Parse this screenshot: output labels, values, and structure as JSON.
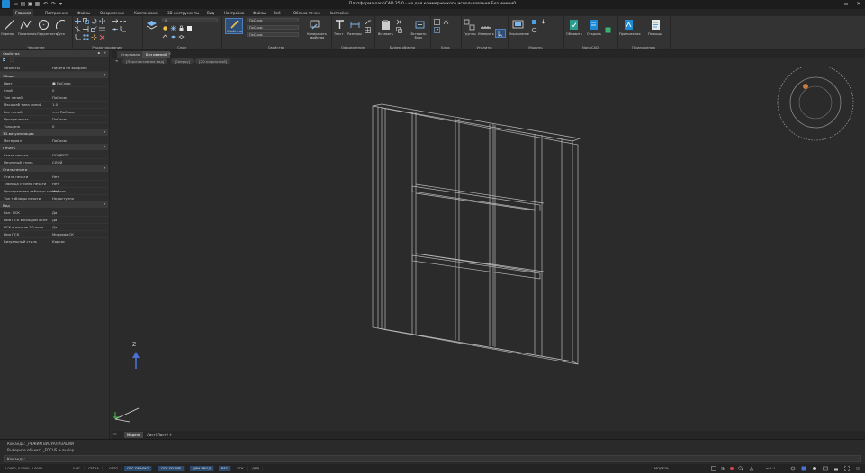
{
  "window": {
    "title": "Платформа nanoCAD 25.0 - не для коммерческого использования Без имени0"
  },
  "ribbon_tabs": [
    "Главная",
    "Построение",
    "Файлы",
    "Оформление",
    "Компоновка",
    "3D-инструменты",
    "Вид",
    "Настройка",
    "Файлы",
    "Веб",
    "Облака точек",
    "Настройки"
  ],
  "ribbon": {
    "groups": [
      {
        "label": "Черчение"
      },
      {
        "label": "Редактирование"
      },
      {
        "label": "Слои"
      },
      {
        "label": "Свойства"
      },
      {
        "label": "Оформление"
      },
      {
        "label": "Буфер обмена"
      },
      {
        "label": "Блок"
      },
      {
        "label": "Утилиты"
      },
      {
        "label": "Модуль"
      },
      {
        "label": "NanoCAD"
      },
      {
        "label": "Приложения"
      }
    ],
    "draw_labels": [
      "Отрезок",
      "Полилиния",
      "Окружность",
      "Дуга"
    ],
    "layer_combo": "0",
    "prop_combo_1": "ПоСлою",
    "prop_combo_2": "ПоСлою",
    "prop_combo_3": "ПоСлою",
    "properties_btn": "Свойства",
    "match_btn": "Копировать свойства",
    "text_btn": "Текст",
    "dim_btn": "Размеры",
    "paste_btn": "Вставить",
    "insert_btn": "Вставить блок",
    "utils_btn": "Группы",
    "measure_btn": "Измерить",
    "module_btn": "Управление",
    "nano_btn1": "Обновить",
    "nano_btn2": "Открыть",
    "apps_btn1": "Приложения",
    "apps_btn2": "Помощь"
  },
  "properties_panel": {
    "title": "Свойства",
    "selection": "Ничего не выбрано",
    "sections": [
      {
        "name": "Общие",
        "rows": [
          {
            "k": "Цвет",
            "v": "■ ПоСлою"
          },
          {
            "k": "Слой",
            "v": "0"
          },
          {
            "k": "Тип линий",
            "v": "ПоСлою"
          },
          {
            "k": "Масштаб типа линий",
            "v": "1.0"
          },
          {
            "k": "Вес линий",
            "v": "—— ПоСлою"
          },
          {
            "k": "Прозрачность",
            "v": "ПоСлою"
          },
          {
            "k": "Толщина",
            "v": "0"
          }
        ]
      },
      {
        "name": "3D-визуализация",
        "rows": [
          {
            "k": "Материал",
            "v": "ПоСлою"
          }
        ]
      },
      {
        "name": "Печать",
        "rows": [
          {
            "k": "Стиль печати",
            "v": "ПОЦВЕТУ"
          },
          {
            "k": "Печатный стиль",
            "v": "СЛОЙ"
          }
        ]
      },
      {
        "name": "Стиль печати",
        "rows": [
          {
            "k": "Стиль печати",
            "v": "Нет"
          },
          {
            "k": "Таблица стилей печати",
            "v": "Нет"
          },
          {
            "k": "Пространство таблицы стилей",
            "v": "Модель"
          },
          {
            "k": "Тип таблицы печати",
            "v": "Недоступно"
          }
        ]
      },
      {
        "name": "Вид",
        "rows": [
          {
            "k": "Вкл. ПСК",
            "v": "Да"
          },
          {
            "k": "Имя ПСК в каждом окне",
            "v": "Да"
          },
          {
            "k": "ПСК в начале 3D-окна",
            "v": "Да"
          },
          {
            "k": "Имя ПСК",
            "v": "Мировая СК"
          },
          {
            "k": "Визуальный стиль",
            "v": "Каркас"
          }
        ]
      }
    ]
  },
  "doc_tabs": [
    "Стартовая",
    "Без имени0"
  ],
  "view_controls": [
    "[Перспективная вид]",
    "[Сверху]",
    "[2D каркасный]"
  ],
  "viewcube": {
    "label": "Ю"
  },
  "ucs": {
    "z_label": "Z"
  },
  "layout_tabs": [
    "Модель",
    "Лист1",
    "Лист2",
    "+"
  ],
  "command_lines": [
    "Команда: _РЕЖИМ ВИЗУАЛИЗАЦИИ",
    "Выберите объект: _FOCUS + выбор",
    "Команда:"
  ],
  "status": {
    "coords": "0.0000, 0.0000, 0.0000",
    "items": [
      "ШАГ",
      "СЕТКА",
      "ОРТО",
      "ОТС-ОБЪЕКТ",
      "ОТС-ПОЛЯР",
      "ДИН-ВВОД",
      "ВЕС",
      "ЛСК",
      "ДВД"
    ],
    "active": [
      3,
      4,
      5,
      6
    ],
    "model": "МОДЕЛЬ",
    "scale": "m 1:1"
  },
  "colors": {
    "accent": "#1e8ad6",
    "bg": "#2b2b2b"
  }
}
